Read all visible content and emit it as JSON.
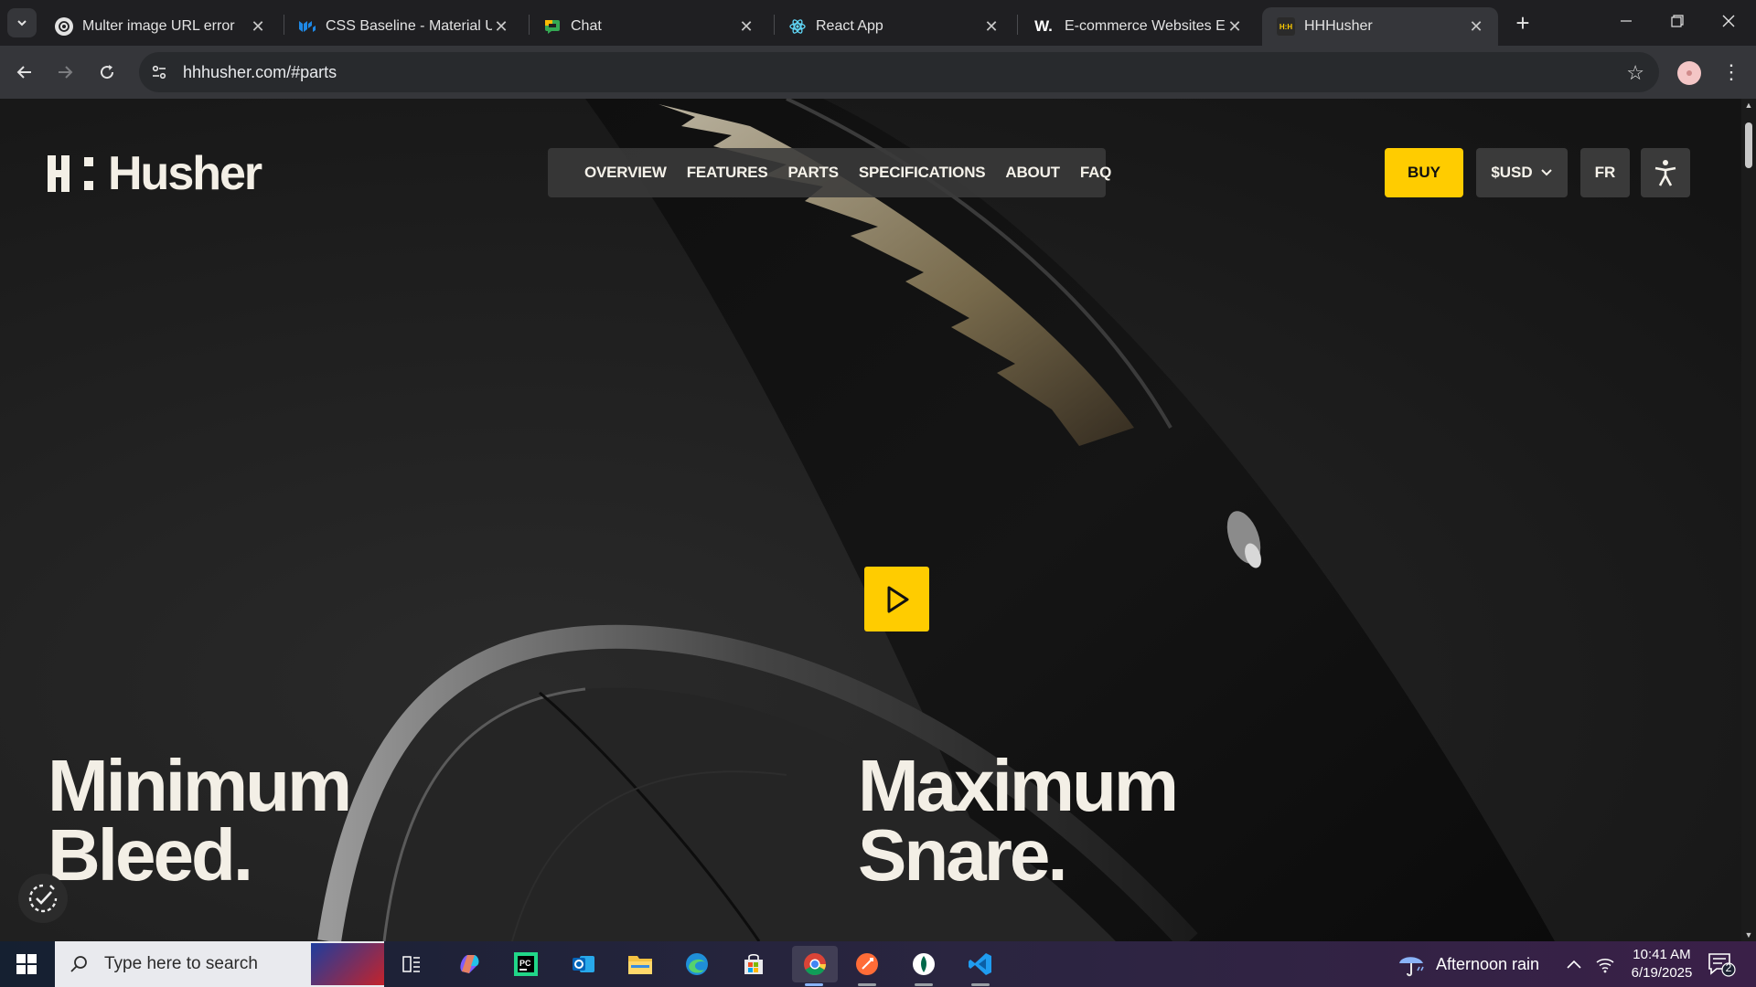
{
  "browser": {
    "tabs": [
      {
        "title": "Multer image URL error",
        "icon": "openai-icon",
        "active": false
      },
      {
        "title": "CSS Baseline - Material UI",
        "icon": "mui-icon",
        "active": false
      },
      {
        "title": "Chat",
        "icon": "google-chat-icon",
        "active": false
      },
      {
        "title": "React App",
        "icon": "react-icon",
        "active": false
      },
      {
        "title": "E-commerce Websites Exar",
        "icon": "w-icon",
        "active": false,
        "favicon_text": "W."
      },
      {
        "title": "HHHusher",
        "icon": "hhhusher-icon",
        "active": true,
        "favicon_text": "H:H"
      }
    ],
    "url": "hhhusher.com/#parts"
  },
  "site": {
    "logo_text": "Husher",
    "nav": [
      "OVERVIEW",
      "FEATURES",
      "PARTS",
      "SPECIFICATIONS",
      "ABOUT",
      "FAQ"
    ],
    "buy_label": "BUY",
    "currency_label": "$USD",
    "lang_label": "FR",
    "headline_left": [
      "Minimum",
      "Bleed."
    ],
    "headline_right": [
      "Maximum",
      "Snare."
    ],
    "colors": {
      "accent": "#ffcc00",
      "text": "#f3efe6",
      "nav_bg": "#3a3a3a"
    }
  },
  "taskbar": {
    "search_placeholder": "Type here to search",
    "apps": [
      "task-view-icon",
      "copilot-icon",
      "pycharm-icon",
      "outlook-icon",
      "file-explorer-icon",
      "edge-icon",
      "microsoft-store-icon",
      "chrome-icon",
      "postman-icon",
      "mongodb-compass-icon",
      "vscode-icon"
    ],
    "weather": "Afternoon rain",
    "time": "10:41 AM",
    "date": "6/19/2025",
    "notification_count": "2"
  }
}
